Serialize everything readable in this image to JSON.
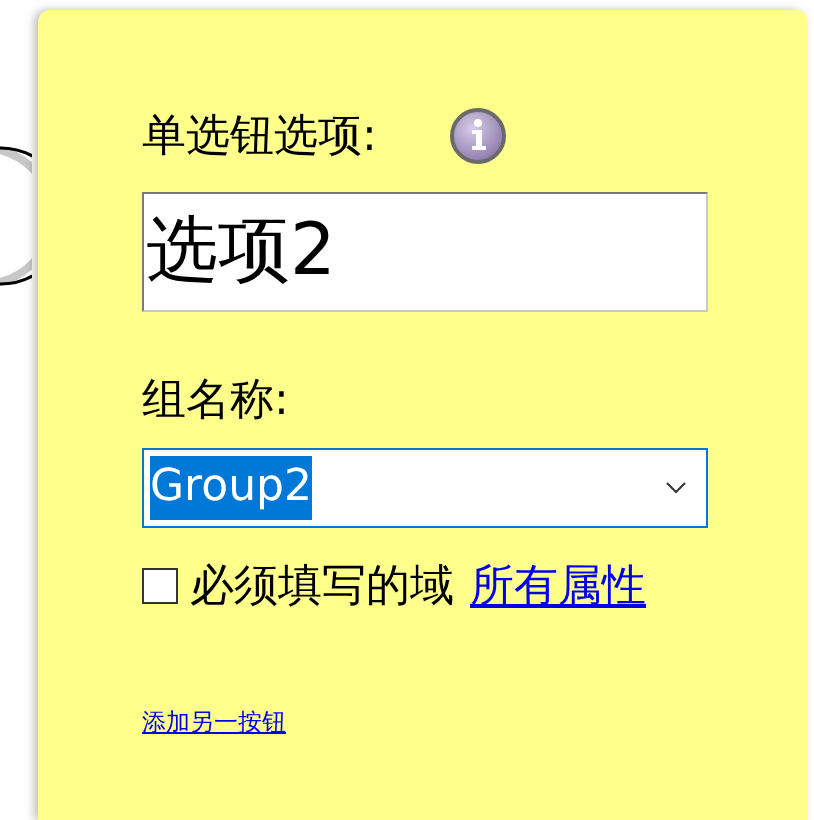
{
  "radio_options_label": "单选钮选项:",
  "option_field": {
    "value": "选项2"
  },
  "group_label": "组名称:",
  "group_select": {
    "value": "Group2",
    "highlighted": true
  },
  "required_checkbox": {
    "label": "必须填写的域",
    "checked": false
  },
  "properties_link": "所有属性",
  "add_button_link": "添加另一按钮"
}
